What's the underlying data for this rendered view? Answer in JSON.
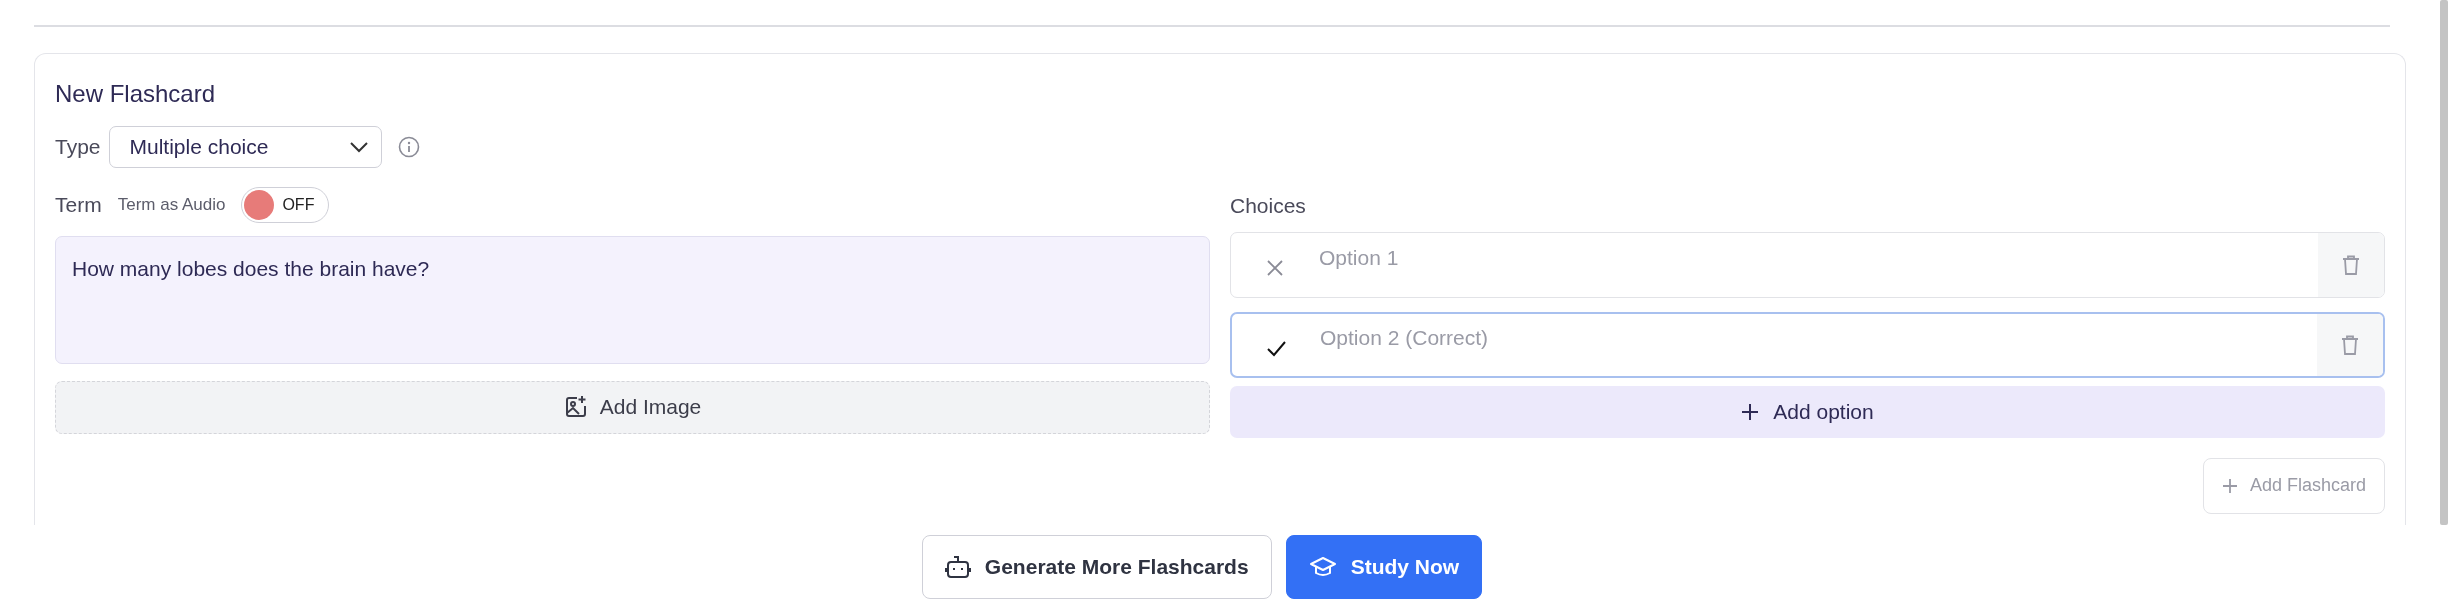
{
  "card": {
    "title": "New Flashcard"
  },
  "type_field": {
    "label": "Type",
    "value": "Multiple choice"
  },
  "term": {
    "label": "Term",
    "audio_label": "Term as Audio",
    "audio_toggle": {
      "label": "OFF",
      "on": false
    },
    "value": "How many lobes does the brain have?"
  },
  "add_image_button": "Add Image",
  "choices": {
    "label": "Choices",
    "options": [
      {
        "placeholder": "Option 1",
        "correct": false,
        "focused": false
      },
      {
        "placeholder": "Option 2 (Correct)",
        "correct": true,
        "focused": true
      }
    ],
    "add_option_button": "Add option"
  },
  "add_flashcard_button": {
    "label": "Add Flashcard",
    "disabled": true
  },
  "actions": [
    {
      "label": "Generate More Flashcards",
      "kind": "outline"
    },
    {
      "label": "Study Now",
      "kind": "primary"
    }
  ]
}
